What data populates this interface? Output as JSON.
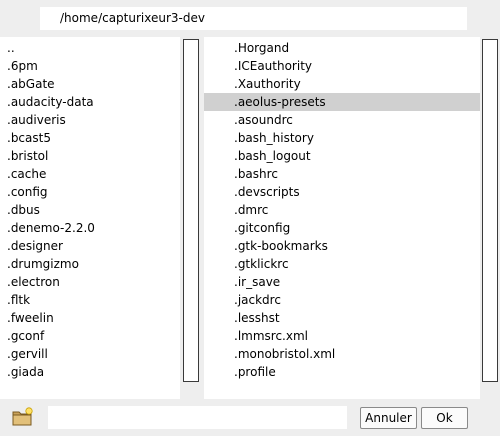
{
  "path": "/home/capturixeur3-dev",
  "directories": [
    "..",
    ".6pm",
    ".abGate",
    ".audacity-data",
    ".audiveris",
    ".bcast5",
    ".bristol",
    ".cache",
    ".config",
    ".dbus",
    ".denemo-2.2.0",
    ".designer",
    ".drumgizmo",
    ".electron",
    ".fltk",
    ".fweelin",
    ".gconf",
    ".gervill",
    ".giada"
  ],
  "files": [
    ".Horgand",
    ".ICEauthority",
    ".Xauthority",
    ".aeolus-presets",
    ".asoundrc",
    ".bash_history",
    ".bash_logout",
    ".bashrc",
    ".devscripts",
    ".dmrc",
    ".gitconfig",
    ".gtk-bookmarks",
    ".gtklickrc",
    ".ir_save",
    ".jackdrc",
    ".lesshst",
    ".lmmsrc.xml",
    ".monobristol.xml",
    ".profile"
  ],
  "selected_file": ".aeolus-presets",
  "filename_value": "",
  "buttons": {
    "cancel": "Annuler",
    "ok": "Ok"
  },
  "icons": {
    "new_folder": "new-folder-icon"
  },
  "colors": {
    "selection": "#d0d0d0",
    "background": "#eeeeee"
  }
}
